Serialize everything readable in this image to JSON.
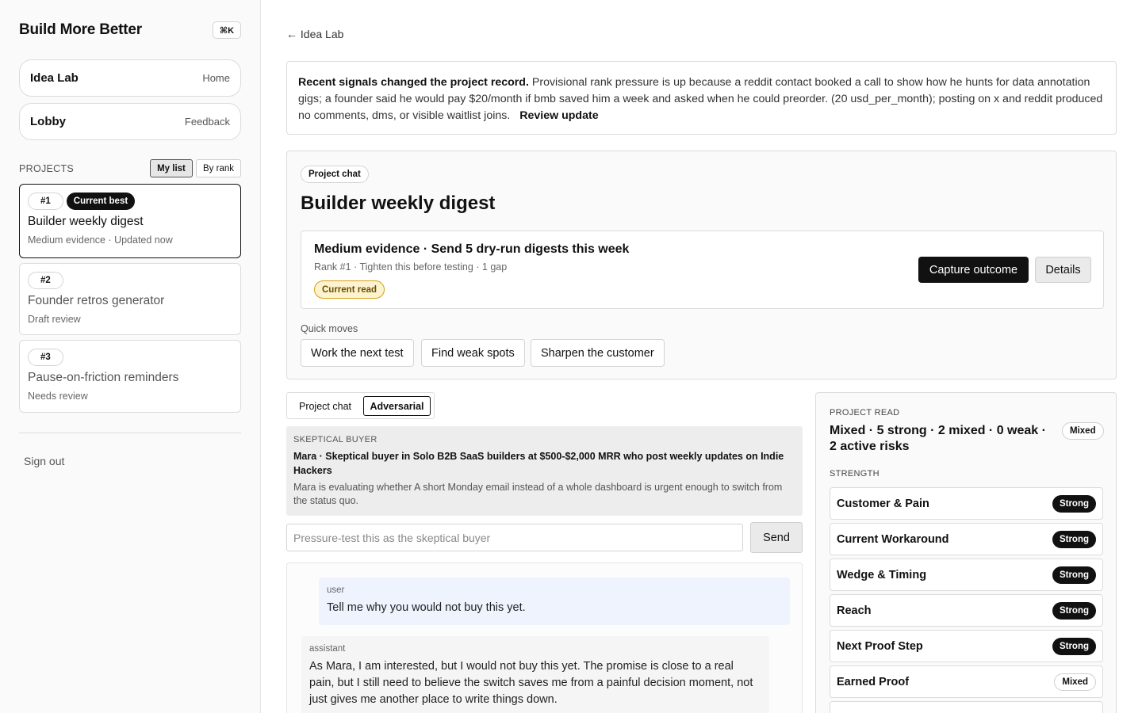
{
  "sidebar": {
    "brand": "Build More Better",
    "shortcut": "⌘K",
    "nav": [
      {
        "label": "Idea Lab",
        "hint": "Home"
      },
      {
        "label": "Lobby",
        "hint": "Feedback"
      }
    ],
    "projects_label": "PROJECTS",
    "sort_options": [
      "My list",
      "By rank"
    ],
    "sort_selected": "My list",
    "projects": [
      {
        "rank": "#1",
        "badge": "Current best",
        "title": "Builder weekly digest",
        "subtitle": "Medium evidence · Updated now"
      },
      {
        "rank": "#2",
        "title": "Founder retros generator",
        "subtitle": "Draft review"
      },
      {
        "rank": "#3",
        "title": "Pause-on-friction reminders",
        "subtitle": "Needs review"
      }
    ],
    "sign_out": "Sign out"
  },
  "main": {
    "back_link": "← Idea Lab",
    "banner": {
      "lead": "Recent signals changed the project record.",
      "body": "Provisional rank pressure is up because a reddit contact booked a call to show how he hunts for data annotation gigs; a founder said he would pay $20/month if bmb saved him a week and asked when he could preorder. (20 usd_per_month); posting on x and reddit produced no comments, dms, or visible waitlist joins.",
      "action": "Review update"
    },
    "hero": {
      "chip": "Project chat",
      "title": "Builder weekly digest",
      "status_heading": "Medium evidence · Send 5 dry-run digests this week",
      "status_sub": "Rank #1 · Tighten this before testing · 1 gap",
      "status_badge": "Current read",
      "primary_button": "Capture outcome",
      "secondary_button": "Details",
      "quick_moves_label": "Quick moves",
      "quick_moves": [
        "Work the next test",
        "Find weak spots",
        "Sharpen the customer"
      ]
    },
    "tabs": [
      "Project chat",
      "Adversarial"
    ],
    "tab_selected": "Adversarial",
    "buyer": {
      "kicker": "SKEPTICAL BUYER",
      "name": "Mara · Skeptical buyer in Solo B2B SaaS builders at $500-$2,000 MRR who post weekly updates on Indie Hackers",
      "description": "Mara is evaluating whether A short Monday email instead of a whole dashboard is urgent enough to switch from the status quo."
    },
    "chat_input": {
      "placeholder": "Pressure-test this as the skeptical buyer",
      "send_label": "Send"
    },
    "messages": [
      {
        "role": "user",
        "text": "Tell me why you would not buy this yet."
      },
      {
        "role": "assistant",
        "text": "As Mara, I am interested, but I would not buy this yet. The promise is close to a real pain, but I still need to believe the switch saves me from a painful decision moment, not just gives me another place to write things down."
      }
    ]
  },
  "project_read": {
    "kicker": "PROJECT READ",
    "summary": "Mixed · 5 strong · 2 mixed · 0 weak · 2 active risks",
    "overall": "Mixed",
    "strength_label": "STRENGTH",
    "items": [
      {
        "label": "Customer & Pain",
        "status": "Strong"
      },
      {
        "label": "Current Workaround",
        "status": "Strong"
      },
      {
        "label": "Wedge & Timing",
        "status": "Strong"
      },
      {
        "label": "Reach",
        "status": "Strong"
      },
      {
        "label": "Next Proof Step",
        "status": "Strong"
      },
      {
        "label": "Earned Proof",
        "status": "Mixed"
      }
    ]
  },
  "colors": {
    "accent_dark": "#111111",
    "current_read_bg": "#fdf3cf",
    "current_read_border": "#d4a017",
    "user_msg_bg": "#eef3fe"
  }
}
